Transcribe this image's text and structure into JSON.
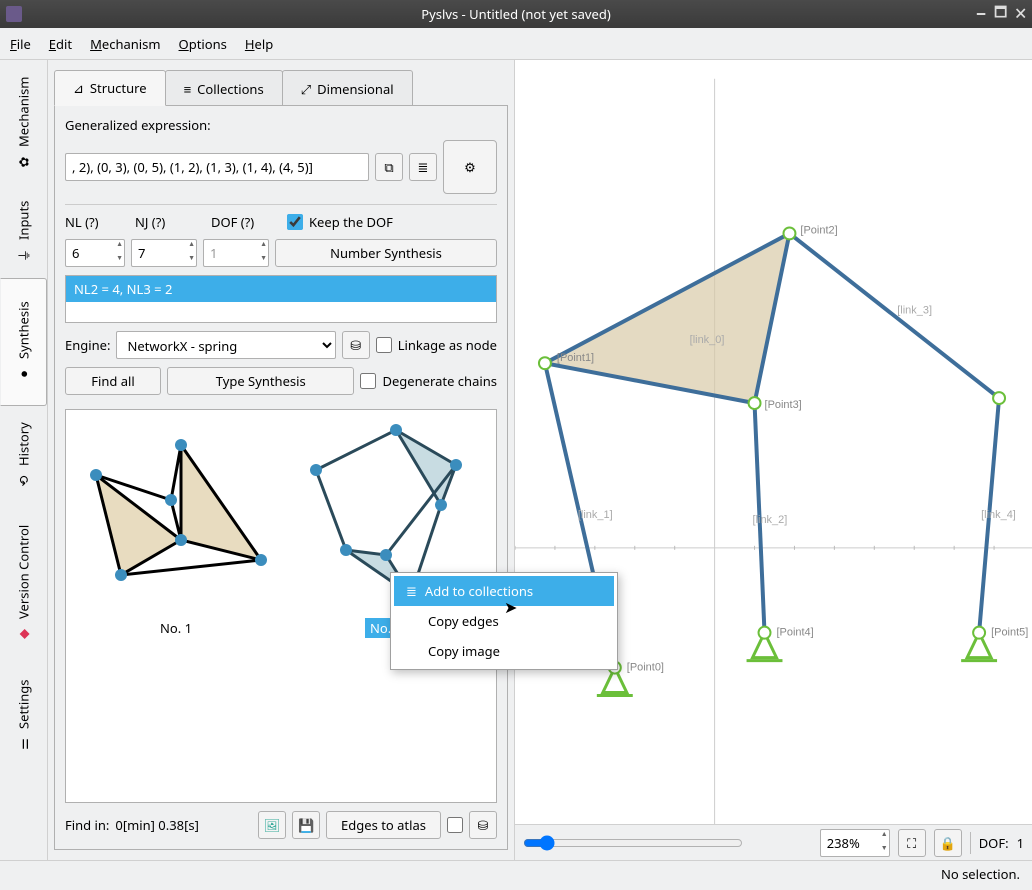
{
  "title": "Pyslvs - Untitled (not yet saved)",
  "menu": {
    "file": "File",
    "edit": "Edit",
    "mechanism": "Mechanism",
    "options": "Options",
    "help": "Help"
  },
  "vtabs": {
    "mechanism": "Mechanism",
    "inputs": "Inputs",
    "synthesis": "Synthesis",
    "history": "History",
    "version": "Version Control",
    "settings": "Settings"
  },
  "htabs": {
    "structure": "Structure",
    "collections": "Collections",
    "dimensional": "Dimensional"
  },
  "panel": {
    "gen_expr_label": "Generalized expression:",
    "gen_expr_value": ", 2), (0, 3), (0, 5), (1, 2), (1, 3), (1, 4), (4, 5)]",
    "nl_label": "NL (?)",
    "nl_value": "6",
    "nj_label": "NJ (?)",
    "nj_value": "7",
    "dof_label": "DOF (?)",
    "dof_value": "1",
    "keep_dof": "Keep the DOF",
    "number_synthesis": "Number Synthesis",
    "result_item": "NL2 = 4, NL3 = 2",
    "engine_label": "Engine:",
    "engine_value": "NetworkX - spring",
    "linkage_as_node": "Linkage as node",
    "find_all": "Find all",
    "type_synthesis": "Type Synthesis",
    "degenerate": "Degenerate chains",
    "thumb1": "No. 1",
    "thumb2": "No. 2",
    "find_in_label": "Find in:",
    "find_in_value": "0[min] 0.38[s]",
    "edges_to_atlas": "Edges to atlas"
  },
  "ctxmenu": {
    "add": "Add to collections",
    "copy_edges": "Copy edges",
    "copy_image": "Copy image"
  },
  "canvas": {
    "zoom": "238%",
    "dof_label": "DOF:",
    "dof_value": "1",
    "points": [
      "[Point0]",
      "[Point1]",
      "[Point2]",
      "[Point3]",
      "[Point4]",
      "[Point5]"
    ],
    "links": [
      "[link_0]",
      "[link_1]",
      "[link_2]",
      "[link_3]",
      "[link_4]"
    ]
  },
  "status": "No selection."
}
